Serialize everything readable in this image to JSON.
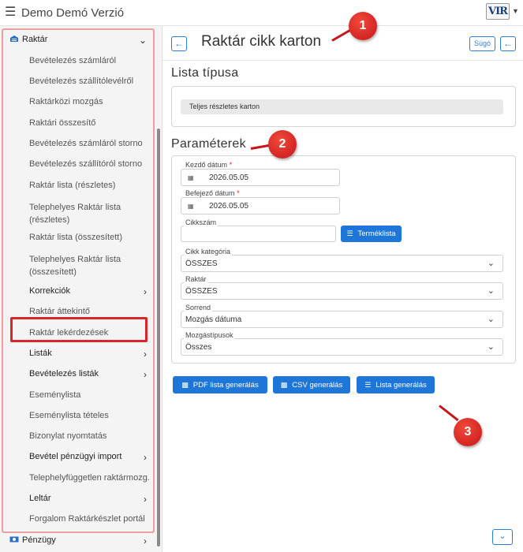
{
  "app": {
    "title": "Demo Demó Verzió",
    "logo_text": "VIR"
  },
  "sidebar": {
    "header": {
      "label": "Raktár"
    },
    "items": [
      {
        "label": "Bevételezés számláról",
        "chevron": false
      },
      {
        "label": "Bevételezés szállítólevélről",
        "chevron": false
      },
      {
        "label": "Raktárközi mozgás",
        "chevron": false
      },
      {
        "label": "Raktári összesítő",
        "chevron": false
      },
      {
        "label": "Bevételezés számláról storno",
        "chevron": false
      },
      {
        "label": "Bevételezés szállítóról storno",
        "chevron": false
      },
      {
        "label": "Raktár lista (részletes)",
        "chevron": false
      },
      {
        "label": "Telephelyes Raktár lista",
        "label2": "(részletes)",
        "chevron": false
      },
      {
        "label": "Raktár lista (összesített)",
        "chevron": false
      },
      {
        "label": "Telephelyes Raktár lista",
        "label2": "(összesített)",
        "chevron": false
      },
      {
        "label": "Korrekciók",
        "chevron": true
      },
      {
        "label": "Raktár áttekintő",
        "chevron": false
      },
      {
        "label": "Raktár lekérdezések",
        "chevron": false
      },
      {
        "label": "Listák",
        "chevron": true
      },
      {
        "label": "Bevételezés listák",
        "chevron": true
      },
      {
        "label": "Eseménylista",
        "chevron": false
      },
      {
        "label": "Eseménylista tételes",
        "chevron": false
      },
      {
        "label": "Bizonylat nyomtatás",
        "chevron": false
      },
      {
        "label": "Bevétel pénzügyi import",
        "chevron": true
      },
      {
        "label": "Telephelyfüggetlen raktármozg.",
        "chevron": false
      },
      {
        "label": "Leltár",
        "chevron": true
      },
      {
        "label": "Forgalom Raktárkészlet portál",
        "chevron": false
      }
    ],
    "footer": {
      "label": "Pénzügy"
    }
  },
  "page": {
    "title": "Raktár cikk karton",
    "help_label": "Súgó"
  },
  "list_type": {
    "section_title": "Lista típusa",
    "value": "Teljes részletes karton"
  },
  "params": {
    "section_title": "Paraméterek",
    "start_date": {
      "label": "Kezdő dátum",
      "value": "2026.05.05"
    },
    "end_date": {
      "label": "Befejező dátum",
      "value": "2026.05.05"
    },
    "item_number": {
      "label": "Cikkszám",
      "value": ""
    },
    "product_list_button": "Terméklista",
    "category": {
      "label": "Cikk kategória",
      "value": "ÖSSZES"
    },
    "warehouse": {
      "label": "Raktár",
      "value": "ÖSSZES"
    },
    "order": {
      "label": "Sorrend",
      "value": "Mozgás dátuma"
    },
    "movement_types": {
      "label": "Mozgástípusok",
      "value": "Összes"
    }
  },
  "actions": {
    "pdf": "PDF lista generálás",
    "csv": "CSV generálás",
    "list": "Lista generálás"
  },
  "annotations": {
    "badge1": "1",
    "badge2": "2",
    "badge3": "3"
  },
  "colors": {
    "primary": "#1e76d9",
    "annotation_red": "#d9262a"
  }
}
